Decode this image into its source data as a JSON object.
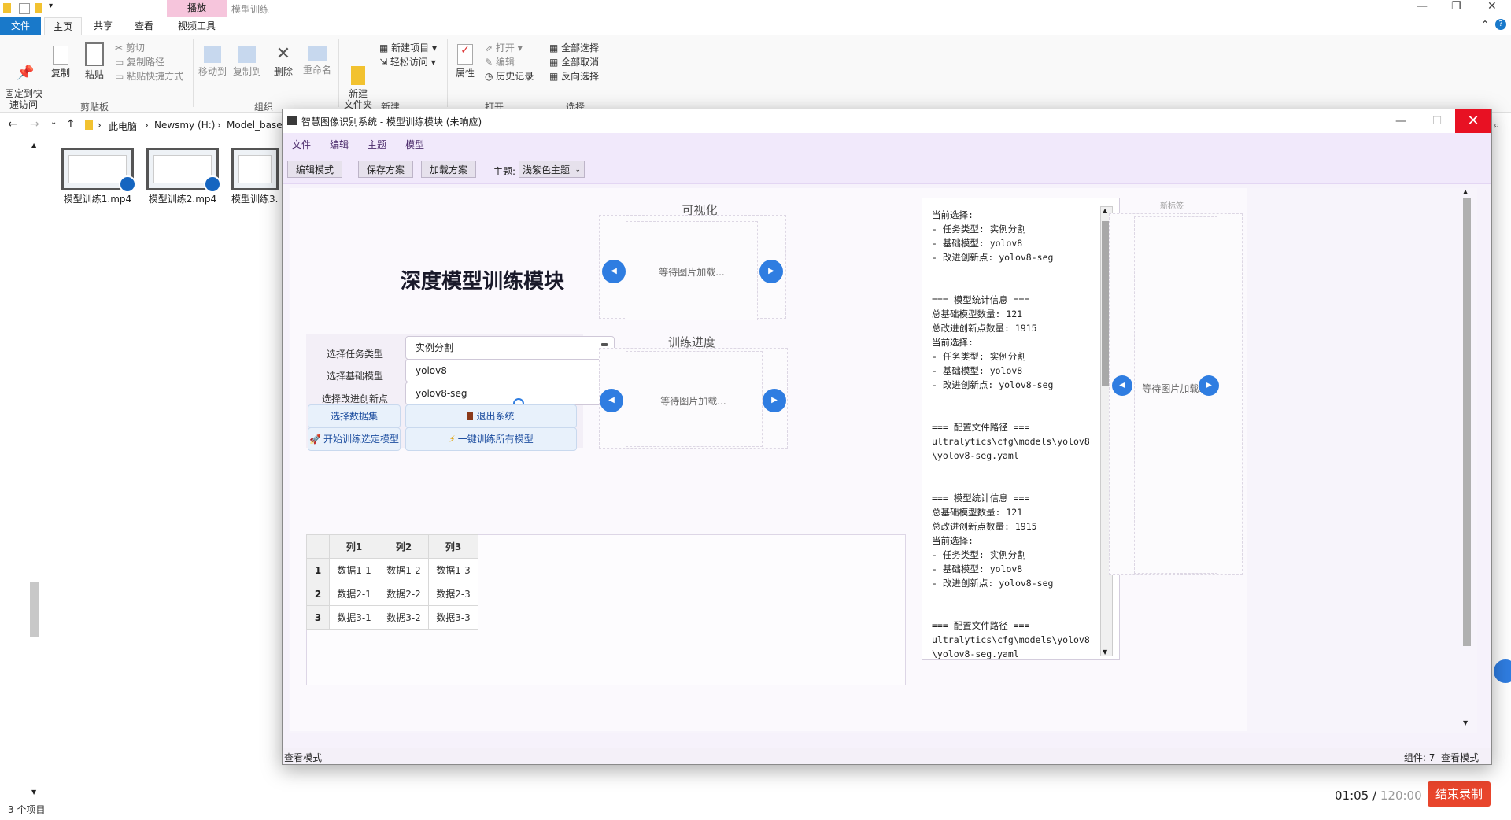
{
  "explorer": {
    "tab_play": "播放",
    "window_title": "模型训练",
    "tabs": [
      "文件",
      "主页",
      "共享",
      "查看",
      "视频工具"
    ],
    "clipboard": {
      "pin": "固定到快\n速访问",
      "copy": "复制",
      "paste": "粘贴",
      "cut": "剪切",
      "copy_path": "复制路径",
      "paste_shortcut": "粘贴快捷方式",
      "group": "剪贴板"
    },
    "organize": {
      "move_to": "移动到",
      "copy_to": "复制到",
      "delete": "删除",
      "rename": "重命名",
      "group": "组织"
    },
    "new": {
      "new_folder": "新建\n文件夹",
      "new_item": "新建项目",
      "easy_access": "轻松访问",
      "group": "新建"
    },
    "open": {
      "properties": "属性",
      "open": "打开",
      "edit": "编辑",
      "history": "历史记录",
      "group": "打开"
    },
    "select": {
      "select_all": "全部选择",
      "select_none": "全部取消",
      "invert": "反向选择",
      "group": "选择"
    },
    "breadcrumb": [
      "此电脑",
      "Newsmy (H:)",
      "Model_base"
    ],
    "files": [
      "模型训练1.mp4",
      "模型训练2.mp4",
      "模型训练3."
    ],
    "item_count": "3 个项目"
  },
  "recording": {
    "time": "01:05",
    "total": "120:00",
    "stop": "结束录制"
  },
  "app": {
    "title": "智慧图像识别系统 - 模型训练模块 (未响应)",
    "menu": [
      "文件",
      "编辑",
      "主题",
      "模型"
    ],
    "toolbar": {
      "edit_mode": "编辑模式",
      "save": "保存方案",
      "load": "加载方案",
      "theme_label": "主题:",
      "theme_value": "浅紫色主题"
    },
    "main_title": "深度模型训练模块",
    "form": {
      "task_label": "选择任务类型",
      "task_value": "实例分割",
      "base_label": "选择基础模型",
      "base_value": "yolov8",
      "improve_label": "选择改进创新点",
      "improve_value": "yolov8-seg"
    },
    "buttons": {
      "dataset": "选择数据集",
      "exit": "退出系统",
      "train_selected": "开始训练选定模型",
      "train_all": "一键训练所有模型"
    },
    "visualize_title": "可视化",
    "progress_title": "训练进度",
    "waiting": "等待图片加载...",
    "new_tab_label": "新标签",
    "table": {
      "headers": [
        "列1",
        "列2",
        "列3"
      ],
      "rows": [
        {
          "id": "1",
          "cells": [
            "数据1-1",
            "数据1-2",
            "数据1-3"
          ]
        },
        {
          "id": "2",
          "cells": [
            "数据2-1",
            "数据2-2",
            "数据2-3"
          ]
        },
        {
          "id": "3",
          "cells": [
            "数据3-1",
            "数据3-2",
            "数据3-3"
          ]
        }
      ]
    },
    "log": "当前选择:\n- 任务类型: 实例分割\n- 基础模型: yolov8\n- 改进创新点: yolov8-seg\n\n\n=== 模型统计信息 ===\n总基础模型数量: 121\n总改进创新点数量: 1915\n当前选择:\n- 任务类型: 实例分割\n- 基础模型: yolov8\n- 改进创新点: yolov8-seg\n\n\n=== 配置文件路径 ===\nultralytics\\cfg\\models\\yolov8\n\\yolov8-seg.yaml\n\n\n=== 模型统计信息 ===\n总基础模型数量: 121\n总改进创新点数量: 1915\n当前选择:\n- 任务类型: 实例分割\n- 基础模型: yolov8\n- 改进创新点: yolov8-seg\n\n\n=== 配置文件路径 ===\nultralytics\\cfg\\models\\yolov8\n\\yolov8-seg.yaml",
    "status_left": "查看模式",
    "status_right": "组件: 7  查看模式"
  },
  "colors": {
    "accent_blue": "#2f7de1",
    "close_red": "#e81123",
    "stop_red": "#e8452c",
    "theme_purple": "#f1e9fb"
  }
}
